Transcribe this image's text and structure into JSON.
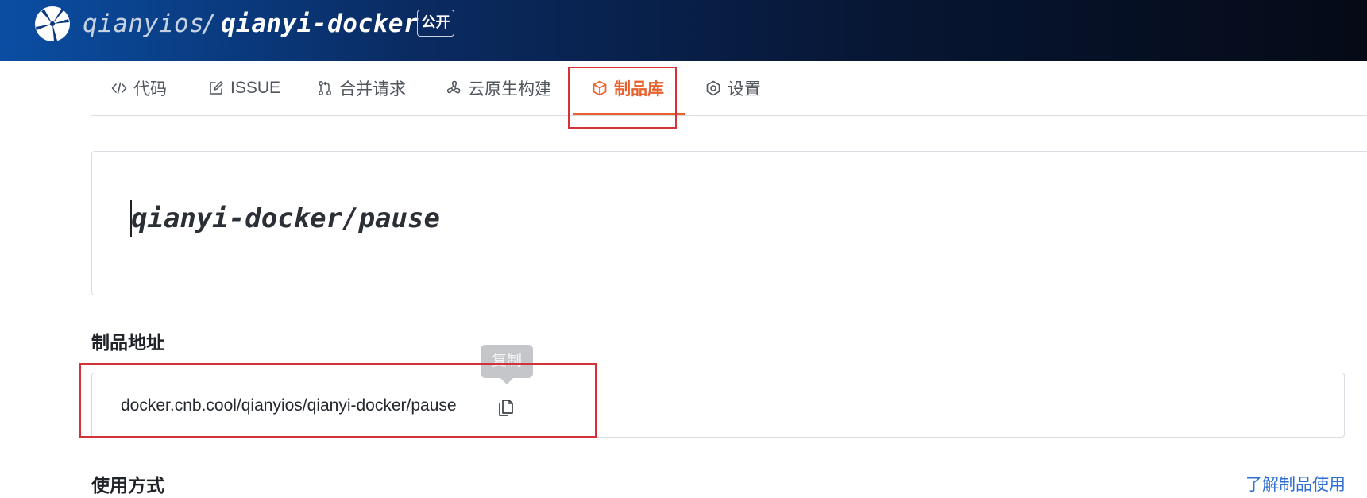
{
  "header": {
    "owner": "qianyios",
    "separator": "/",
    "repo": "qianyi-docker",
    "visibility_badge": "公开"
  },
  "tabs": [
    {
      "label": "代码",
      "icon": "code-icon"
    },
    {
      "label": "ISSUE",
      "icon": "issue-icon"
    },
    {
      "label": "合并请求",
      "icon": "pull-request-icon"
    },
    {
      "label": "云原生构建",
      "icon": "build-icon"
    },
    {
      "label": "制品库",
      "icon": "package-icon",
      "active": true
    },
    {
      "label": "设置",
      "icon": "settings-icon"
    }
  ],
  "package": {
    "title": "qianyi-docker/pause"
  },
  "address_section": {
    "heading": "制品地址",
    "address": "docker.cnb.cool/qianyios/qianyi-docker/pause",
    "copy_tooltip": "复制"
  },
  "usage_section": {
    "heading": "使用方式",
    "learn_link": "了解制品使用"
  },
  "colors": {
    "accent": "#e8612c",
    "highlight_box": "#d2333a",
    "link": "#2f6fd1",
    "header_dark": "#050a16",
    "header_blue": "#0a4ea3"
  }
}
